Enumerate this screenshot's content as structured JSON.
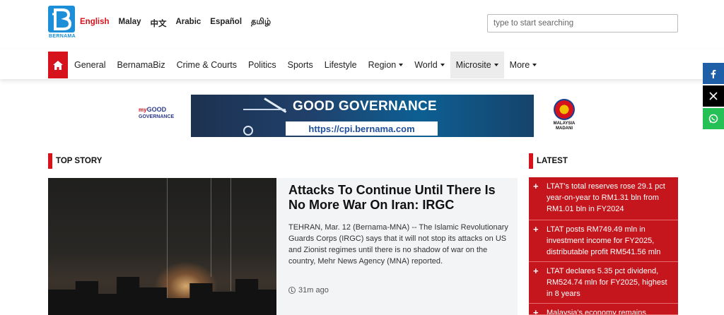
{
  "brand": {
    "logo_text": "BERNAMA"
  },
  "languages": [
    "English",
    "Malay",
    "中文",
    "Arabic",
    "Español",
    "தமிழ்"
  ],
  "search": {
    "placeholder": "type to start searching"
  },
  "nav": {
    "items": [
      {
        "label": "General",
        "dropdown": false
      },
      {
        "label": "BernamaBiz",
        "dropdown": false
      },
      {
        "label": "Crime & Courts",
        "dropdown": false
      },
      {
        "label": "Politics",
        "dropdown": false
      },
      {
        "label": "Sports",
        "dropdown": false
      },
      {
        "label": "Lifestyle",
        "dropdown": false
      },
      {
        "label": "Region",
        "dropdown": true
      },
      {
        "label": "World",
        "dropdown": true
      },
      {
        "label": "Microsite",
        "dropdown": true,
        "highlighted": true
      },
      {
        "label": "More",
        "dropdown": true
      }
    ]
  },
  "banner": {
    "logo_line1": "my",
    "logo_line2": "GOOD",
    "logo_line3": "GOVERNANCE",
    "title": "GOOD GOVERNANCE",
    "url": "https://cpi.bernama.com",
    "right_text1": "MALAYSIA",
    "right_text2": "MADANI"
  },
  "sections": {
    "top_story": "TOP STORY",
    "latest": "LATEST"
  },
  "top_story": {
    "title": "Attacks To Continue Until There Is No More War On Iran: IRGC",
    "summary": "TEHRAN, Mar. 12 (Bernama-MNA) -- The Islamic Revolutionary Guards Corps (IRGC) says that it will not stop its attacks on US and Zionist regimes until there is no shadow of war on the country, Mehr News Agency (MNA) reported.",
    "time": "31m ago"
  },
  "latest": [
    "LTAT's total reserves rose 29.1 pct year-on-year to RM1.31 bln from RM1.01 bln in FY2024",
    "LTAT posts RM749.49 mln in investment income for FY2025, distributable profit RM541.56 mln",
    "LTAT declares 5.35 pct dividend, RM524.74 mln for FY2025, highest in 8 years",
    "Malaysia's economy remains"
  ],
  "colors": {
    "accent": "#d6121c",
    "latest_bg": "#c4161c",
    "brand_blue": "#1d8fd8"
  },
  "social": [
    "facebook-icon",
    "x-icon",
    "whatsapp-icon"
  ]
}
